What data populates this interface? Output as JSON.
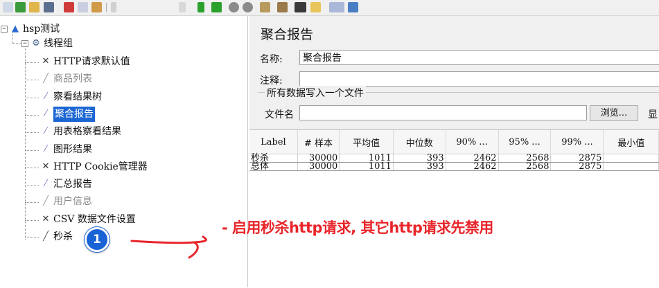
{
  "tree": {
    "root": {
      "label": "hsp测试",
      "expander": "⊟"
    },
    "thread_group": {
      "label": "线程组",
      "expander": "⊟"
    },
    "items": [
      {
        "label": "HTTP请求默认值",
        "icon": "wrench-icon",
        "glyph": "✕",
        "disabled": false
      },
      {
        "label": "商品列表",
        "icon": "pipette-icon",
        "glyph": "╱",
        "disabled": true
      },
      {
        "label": "察看结果树",
        "icon": "graph-icon",
        "glyph": "⁄",
        "disabled": false
      },
      {
        "label": "聚合报告",
        "icon": "graph-icon",
        "glyph": "⁄",
        "disabled": false,
        "selected": true
      },
      {
        "label": "用表格察看结果",
        "icon": "graph-icon",
        "glyph": "⁄",
        "disabled": false
      },
      {
        "label": "图形结果",
        "icon": "graph-icon",
        "glyph": "⁄",
        "disabled": false
      },
      {
        "label": "HTTP Cookie管理器",
        "icon": "wrench-icon",
        "glyph": "✕",
        "disabled": false
      },
      {
        "label": "汇总报告",
        "icon": "graph-icon",
        "glyph": "⁄",
        "disabled": false
      },
      {
        "label": "用户信息",
        "icon": "pipette-icon",
        "glyph": "╱",
        "disabled": true
      },
      {
        "label": "CSV 数据文件设置",
        "icon": "wrench-icon",
        "glyph": "✕",
        "disabled": false
      },
      {
        "label": "秒杀",
        "icon": "pipette-icon",
        "glyph": "╱",
        "disabled": false
      }
    ]
  },
  "panel": {
    "title": "聚合报告",
    "name_label": "名称:",
    "name_value": "聚合报告",
    "comment_label": "注释:",
    "comment_value": "",
    "group_legend": "所有数据写入一个文件",
    "filename_label": "文件名",
    "filename_value": "",
    "browse_button": "浏览...",
    "cut_label": "显"
  },
  "table": {
    "headers": [
      "Label",
      "# 样本",
      "平均值",
      "中位数",
      "90% ...",
      "95% ...",
      "99% ...",
      "最小值"
    ],
    "rows": [
      [
        "秒杀",
        "30000",
        "1011",
        "393",
        "2462",
        "2568",
        "2875",
        ""
      ],
      [
        "总体",
        "30000",
        "1011",
        "393",
        "2462",
        "2568",
        "2875",
        ""
      ]
    ]
  },
  "annotation": {
    "text": "- 启用秒杀http请求, 其它http请求先禁用",
    "badge": "1",
    "color": "#e8252a"
  },
  "colors": {
    "selection": "#1c66d4",
    "badge": "#1a63d6"
  }
}
